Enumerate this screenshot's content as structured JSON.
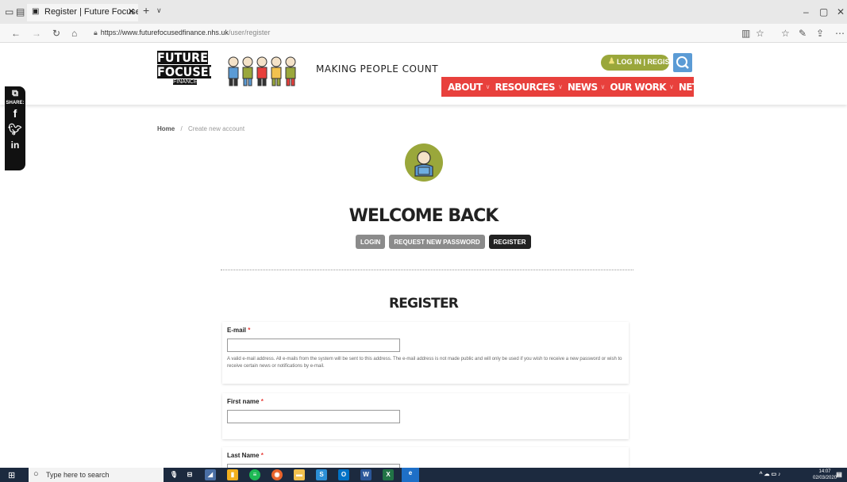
{
  "browser": {
    "tab_title": "Register | Future Focuse",
    "url_host": "https://www.futurefocusedfinance.nhs.uk",
    "url_path": "/user/register"
  },
  "header": {
    "logo_line1": "FUTURE",
    "logo_line2": "FOCUSED",
    "logo_line3": "FINANCE",
    "tagline": "MAKING PEOPLE COUNT",
    "login_label": "LOG IN | REGISTER",
    "nav": [
      {
        "label": "ABOUT"
      },
      {
        "label": "RESOURCES"
      },
      {
        "label": "NEWS"
      },
      {
        "label": "OUR WORK"
      },
      {
        "label": "NETWORKS"
      }
    ]
  },
  "share": {
    "label": "SHARE:"
  },
  "breadcrumb": {
    "home": "Home",
    "sep": "/",
    "current": "Create new account"
  },
  "main": {
    "welcome": "WELCOME BACK",
    "tabs": [
      {
        "label": "LOGIN"
      },
      {
        "label": "REQUEST NEW PASSWORD"
      },
      {
        "label": "REGISTER"
      }
    ],
    "register_title": "REGISTER",
    "fields": {
      "email_label": "E-mail",
      "email_help": "A valid e-mail address. All e-mails from the system will be sent to this address. The e-mail address is not made public and will only be used if you wish to receive a new password or wish to receive certain news or notifications by e-mail.",
      "first_name_label": "First name",
      "last_name_label": "Last Name",
      "required_mark": "*"
    }
  },
  "taskbar": {
    "search_placeholder": "Type here to search",
    "time": "14:07",
    "date": "02/03/2020"
  },
  "colors": {
    "nav_red": "#e8403c",
    "login_green": "#9aa73b",
    "search_blue": "#5b9bd5"
  }
}
